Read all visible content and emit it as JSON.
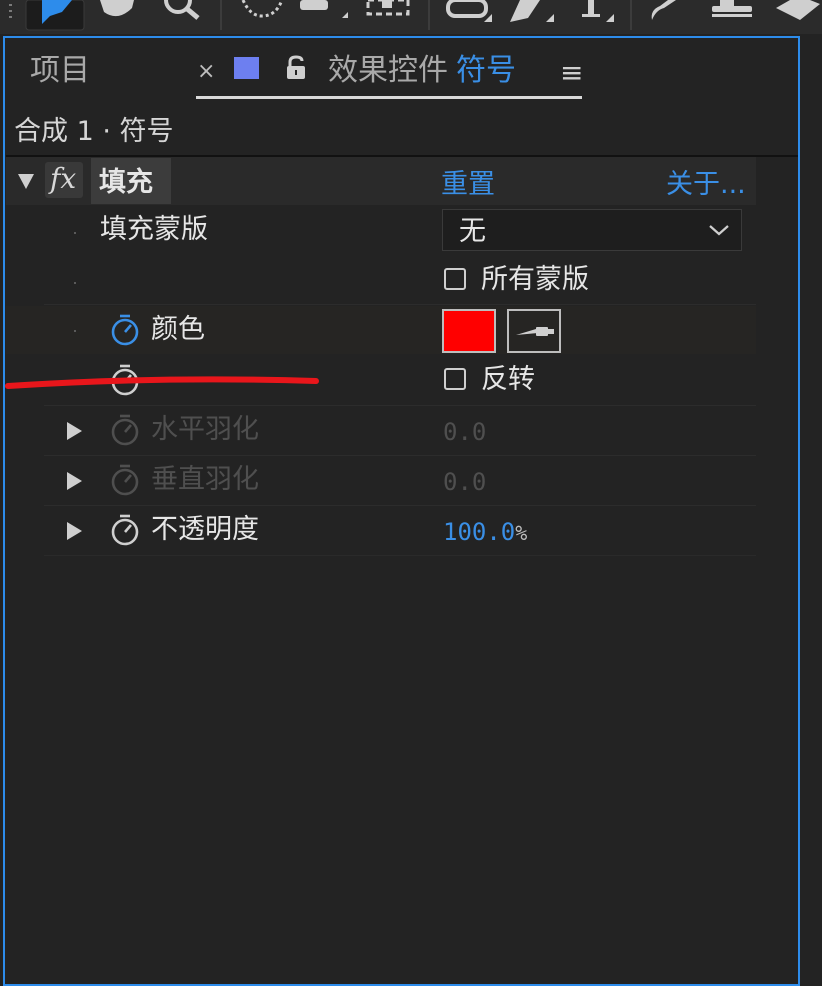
{
  "tabs": {
    "project_label": "项目",
    "close_glyph": "×",
    "effect_controls_label": "效果控件",
    "layer_name": "符号",
    "menu_glyph": "≡"
  },
  "breadcrumb": "合成 1 · 符号",
  "effect": {
    "fx_glyph": "fx",
    "name": "填充",
    "reset_label": "重置",
    "about_label": "关于..."
  },
  "properties": {
    "fill_mask_label": "填充蒙版",
    "fill_mask_value": "无",
    "all_masks_label": "所有蒙版",
    "color_label": "颜色",
    "invert_label": "反转",
    "horizontal_feather_label": "水平羽化",
    "horizontal_feather_value": "0.0",
    "vertical_feather_label": "垂直羽化",
    "vertical_feather_value": "0.0",
    "opacity_label": "不透明度",
    "opacity_value": "100.0",
    "opacity_unit": "%"
  },
  "colors": {
    "accent_blue": "#3a8fe6",
    "fill_color": "#ff0000",
    "panel_border": "#2d8ceb",
    "layer_color": "#6d7ff0",
    "annotation_red": "#e8161b"
  }
}
